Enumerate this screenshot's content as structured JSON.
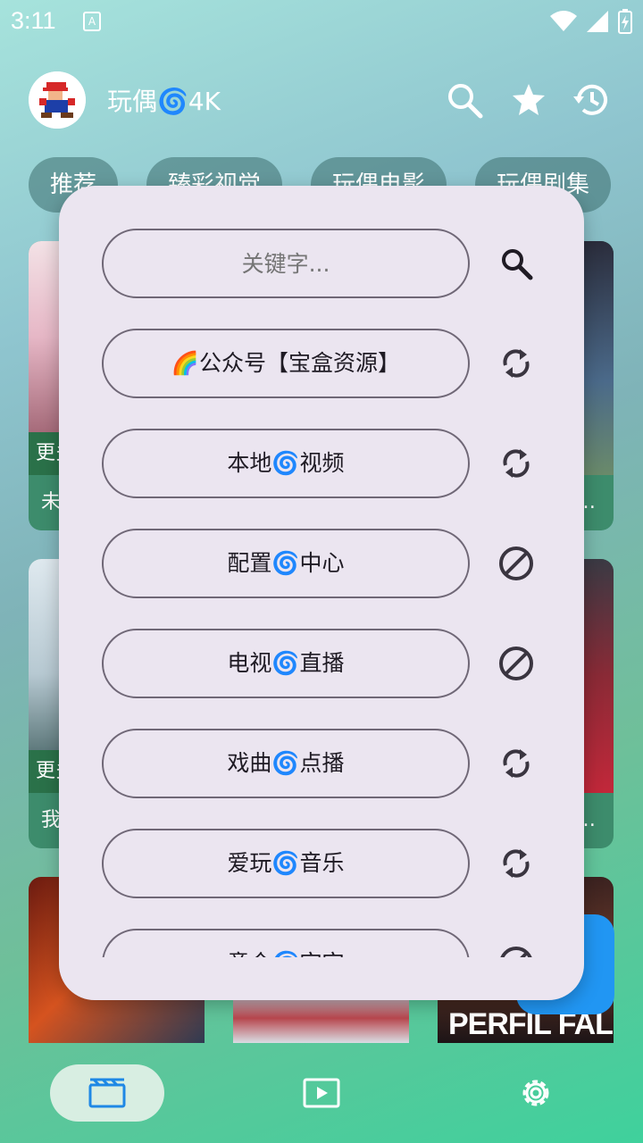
{
  "status": {
    "time": "3:11",
    "notif_glyph": "A"
  },
  "header": {
    "title": "玩偶🌀4K",
    "avatar_icon": "mario-avatar-icon"
  },
  "tabs": [
    "推荐",
    "臻彩视觉",
    "玩偶电影",
    "玩偶剧集"
  ],
  "cards": [
    {
      "tag": "更多",
      "name": "未"
    },
    {
      "tag": "",
      "name": "…"
    },
    {
      "tag": "更多",
      "name": "我"
    },
    {
      "tag": "",
      "name": "…"
    },
    {
      "poster_text": "PERFIL FALSO"
    }
  ],
  "popup": {
    "search_placeholder": "关键字...",
    "sources": [
      {
        "label": "🌈公众号【宝盒资源】",
        "icon": "refresh-icon"
      },
      {
        "label": "本地🌀视频",
        "icon": "refresh-icon"
      },
      {
        "label": "配置🌀中心",
        "icon": "block-icon"
      },
      {
        "label": "电视🌀直播",
        "icon": "block-icon"
      },
      {
        "label": "戏曲🌀点播",
        "icon": "refresh-icon"
      },
      {
        "label": "爱玩🌀音乐",
        "icon": "refresh-icon"
      },
      {
        "label": "童介🌀空空",
        "icon": "block-icon"
      }
    ]
  },
  "bottom_nav": [
    "movie-icon",
    "play-icon",
    "settings-icon"
  ],
  "colors": {
    "accent": "#2196f3",
    "popup_bg": "#ebe5f0",
    "pill_border": "#6f6776"
  }
}
